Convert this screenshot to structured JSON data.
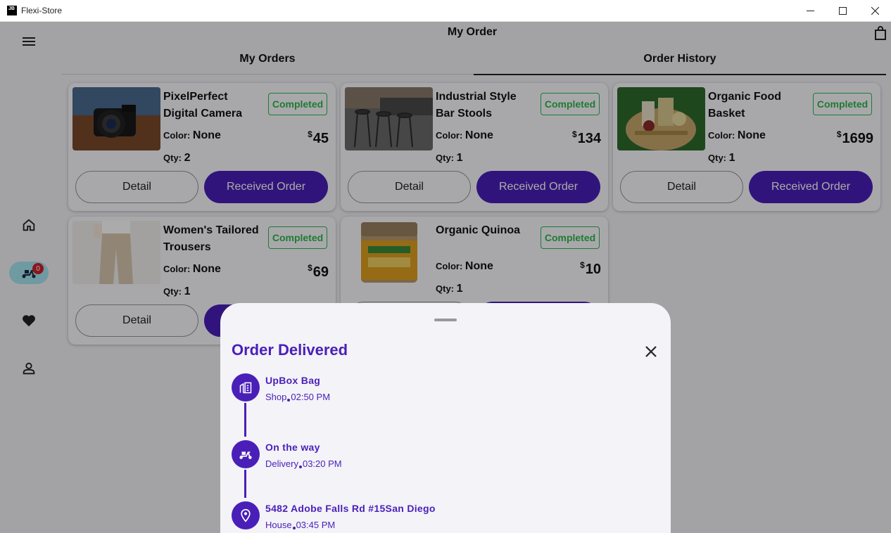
{
  "window": {
    "title": "Flexi-Store",
    "logo_text": "JB"
  },
  "header": {
    "title": "My Order"
  },
  "tabs": [
    {
      "label": "My Orders",
      "active": false
    },
    {
      "label": "Order History",
      "active": true
    }
  ],
  "sidebar": {
    "cart_badge": "0"
  },
  "labels": {
    "color": "Color: ",
    "qty": "Qty: ",
    "currency": "$",
    "detail": "Detail",
    "received": "Received Order"
  },
  "orders": [
    {
      "name": "PixelPerfect Digital Camera",
      "status": "Completed",
      "color": "None",
      "qty": "2",
      "price": "45"
    },
    {
      "name": "Industrial Style Bar Stools",
      "status": "Completed",
      "color": "None",
      "qty": "1",
      "price": "134"
    },
    {
      "name": "Organic Food Basket",
      "status": "Completed",
      "color": "None",
      "qty": "1",
      "price": "1699"
    },
    {
      "name": "Women's Tailored Trousers",
      "status": "Completed",
      "color": "None",
      "qty": "1",
      "price": "69"
    },
    {
      "name": "Organic Quinoa",
      "status": "Completed",
      "color": "None",
      "qty": "1",
      "price": "10"
    }
  ],
  "sheet": {
    "title": "Order Delivered",
    "steps": [
      {
        "title": "UpBox Bag",
        "place": "Shop",
        "time": "02:50 PM",
        "icon": "store-icon"
      },
      {
        "title": "On the way",
        "place": "Delivery",
        "time": "03:20 PM",
        "icon": "scooter-icon"
      },
      {
        "title": "5482 Adobe Falls Rd #15San Diego",
        "place": "House",
        "time": "03:45 PM",
        "icon": "location-pin-icon"
      }
    ]
  },
  "colors": {
    "accent": "#4a1fb8",
    "status": "#2fb84a",
    "badge": "#d0202a",
    "nav_pill": "#a6e6f0"
  }
}
